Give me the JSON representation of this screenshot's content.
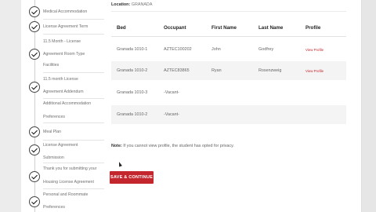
{
  "steps": [
    {
      "lines": [
        "Medical Accommodation"
      ],
      "checked": true
    },
    {
      "lines": [
        "License Agreement Term"
      ],
      "checked": true
    },
    {
      "lines": [
        "11.5 Month - License"
      ],
      "checked": false
    },
    {
      "lines": [
        "Agreement Room Type",
        "Facilities"
      ],
      "checked": true
    },
    {
      "lines": [
        "11.5 month License",
        "Agreement Addendum"
      ],
      "checked": true
    },
    {
      "lines": [
        "Additional Accommodation",
        "Preferences"
      ],
      "checked": false
    },
    {
      "lines": [
        "Meal Plan"
      ],
      "checked": true
    },
    {
      "lines": [
        "License Agreement",
        "Submission"
      ],
      "checked": true
    },
    {
      "lines": [
        "Thank you for submitting your",
        "Housing License Agreement"
      ],
      "checked": true
    },
    {
      "lines": [
        "Personal and Roommate",
        "Preferences"
      ],
      "checked": true
    }
  ],
  "location": {
    "label": "Location:",
    "value": "GRANADA"
  },
  "table": {
    "headers": [
      "Bed",
      "Occupant",
      "First Name",
      "Last Name",
      "Profile"
    ],
    "rows": [
      {
        "bed": "Granada 1010-1",
        "occupant": "AZTEC100202",
        "first": "John",
        "last": "Godfrey",
        "profile": "View Profile"
      },
      {
        "bed": "Granada 1010-2",
        "occupant": "AZTEC83865",
        "first": "Ryan",
        "last": "Rosenzweig",
        "profile": "View Profile"
      },
      {
        "bed": "Granada 1010-3",
        "occupant": "-Vacant-",
        "first": "",
        "last": "",
        "profile": ""
      },
      {
        "bed": "Granada 1010-2",
        "occupant": "-Vacant-",
        "first": "",
        "last": "",
        "profile": ""
      }
    ]
  },
  "note": {
    "label": "Note:",
    "text": "If you cannot view profile, the student has opted for privacy."
  },
  "save_button": "SAVE & CONTINUE"
}
